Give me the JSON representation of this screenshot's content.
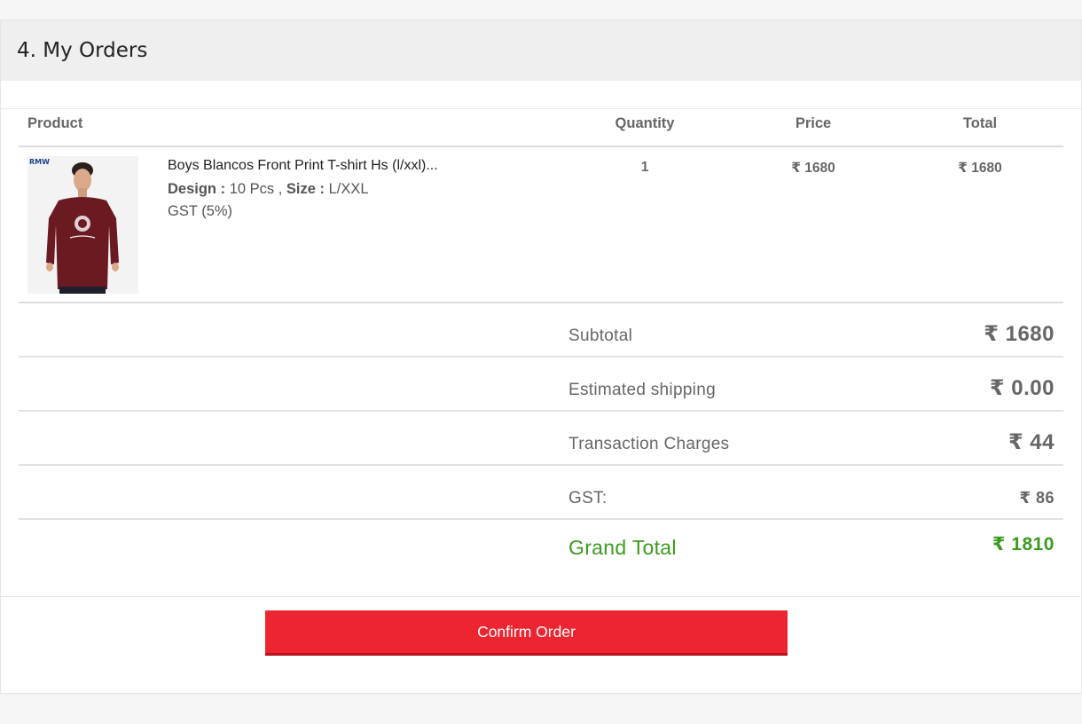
{
  "section": {
    "title": "4. My Orders"
  },
  "table": {
    "columns": {
      "product": "Product",
      "quantity": "Quantity",
      "price": "Price",
      "total": "Total"
    },
    "items": [
      {
        "name": "Boys Blancos Front Print T-shirt Hs (l/xxl)...",
        "design_label": "Design :",
        "design_value": "10 Pcs",
        "size_label": "Size :",
        "size_value": "L/XXL",
        "gst": "GST (5%)",
        "quantity": "1",
        "price": "₹ 1680",
        "total": "₹ 1680",
        "thumbnail_logo": "RMW",
        "thumbnail_icon": "tshirt-product-photo"
      }
    ]
  },
  "summary": {
    "subtotal_label": "Subtotal",
    "subtotal_value": "₹ 1680",
    "shipping_label": "Estimated shipping",
    "shipping_value": "₹ 0.00",
    "transaction_label": "Transaction Charges",
    "transaction_value": "₹ 44",
    "gst_label": "GST:",
    "gst_value": "₹ 86",
    "grand_label": "Grand Total",
    "grand_value": "₹ 1810"
  },
  "actions": {
    "confirm_label": "Confirm Order"
  },
  "colors": {
    "accent": "#ec2530",
    "grand_total": "#3b9a1f",
    "header_bg": "#efefef",
    "shirt": "#6b1a22"
  }
}
